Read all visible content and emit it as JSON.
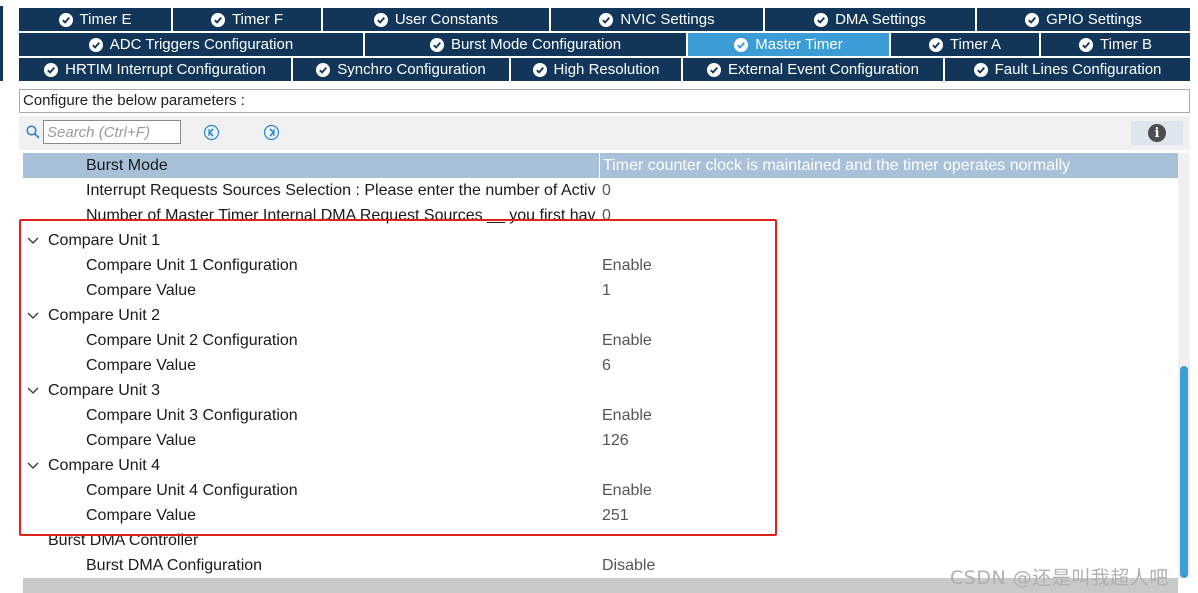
{
  "tabs": {
    "row1": [
      {
        "label": "Timer E"
      },
      {
        "label": "Timer F"
      },
      {
        "label": "User Constants"
      },
      {
        "label": "NVIC Settings"
      },
      {
        "label": "DMA Settings"
      },
      {
        "label": "GPIO Settings"
      }
    ],
    "row2": [
      {
        "label": "ADC Triggers Configuration"
      },
      {
        "label": "Burst Mode Configuration"
      },
      {
        "label": "Master Timer",
        "active": true
      },
      {
        "label": "Timer A"
      },
      {
        "label": "Timer B"
      }
    ],
    "row3": [
      {
        "label": "HRTIM Interrupt Configuration"
      },
      {
        "label": "Synchro Configuration"
      },
      {
        "label": "High Resolution"
      },
      {
        "label": "External Event Configuration"
      },
      {
        "label": "Fault Lines Configuration"
      }
    ]
  },
  "config_header": "Configure the below parameters :",
  "search": {
    "placeholder": "Search (Ctrl+F)"
  },
  "params": [
    {
      "name": "Burst Mode",
      "value": "Timer counter clock is maintained and the timer operates normally",
      "selected": true
    },
    {
      "name": "Interrupt Requests Sources Selection : Please enter the number of Active Interrupt Requests Sources",
      "value": "0"
    },
    {
      "name": "Number of Master Timer Internal DMA Request Sources __ you first have to",
      "value": "0"
    },
    {
      "name": "Compare Unit 1",
      "group": true
    },
    {
      "name": "Compare Unit 1 Configuration",
      "value": "Enable"
    },
    {
      "name": "Compare Value",
      "value": "1"
    },
    {
      "name": "Compare Unit 2",
      "group": true
    },
    {
      "name": "Compare Unit 2 Configuration",
      "value": "Enable"
    },
    {
      "name": "Compare Value",
      "value": "6"
    },
    {
      "name": "Compare Unit 3",
      "group": true
    },
    {
      "name": "Compare Unit 3 Configuration",
      "value": "Enable"
    },
    {
      "name": "Compare Value",
      "value": "126"
    },
    {
      "name": "Compare Unit 4",
      "group": true
    },
    {
      "name": "Compare Unit 4 Configuration",
      "value": "Enable"
    },
    {
      "name": "Compare Value",
      "value": "251"
    },
    {
      "name": "Burst DMA Controller",
      "group": true
    },
    {
      "name": "Burst DMA Configuration",
      "value": "Disable"
    }
  ],
  "watermark": "CSDN @还是叫我超人吧",
  "colors": {
    "tab_bg": "#11365a",
    "tab_active_bg": "#3c9cd6",
    "selected_row_bg": "#a8c0d8",
    "highlight_border": "#e0221c",
    "scroll_thumb": "#3c9cd6"
  },
  "icons": {
    "tab_status": "check-circle-icon",
    "search": "magnifier-icon",
    "previous": "prev-arrow-icon",
    "next": "next-arrow-icon",
    "info": "info-icon",
    "group_toggle": "chevron-down-icon"
  }
}
